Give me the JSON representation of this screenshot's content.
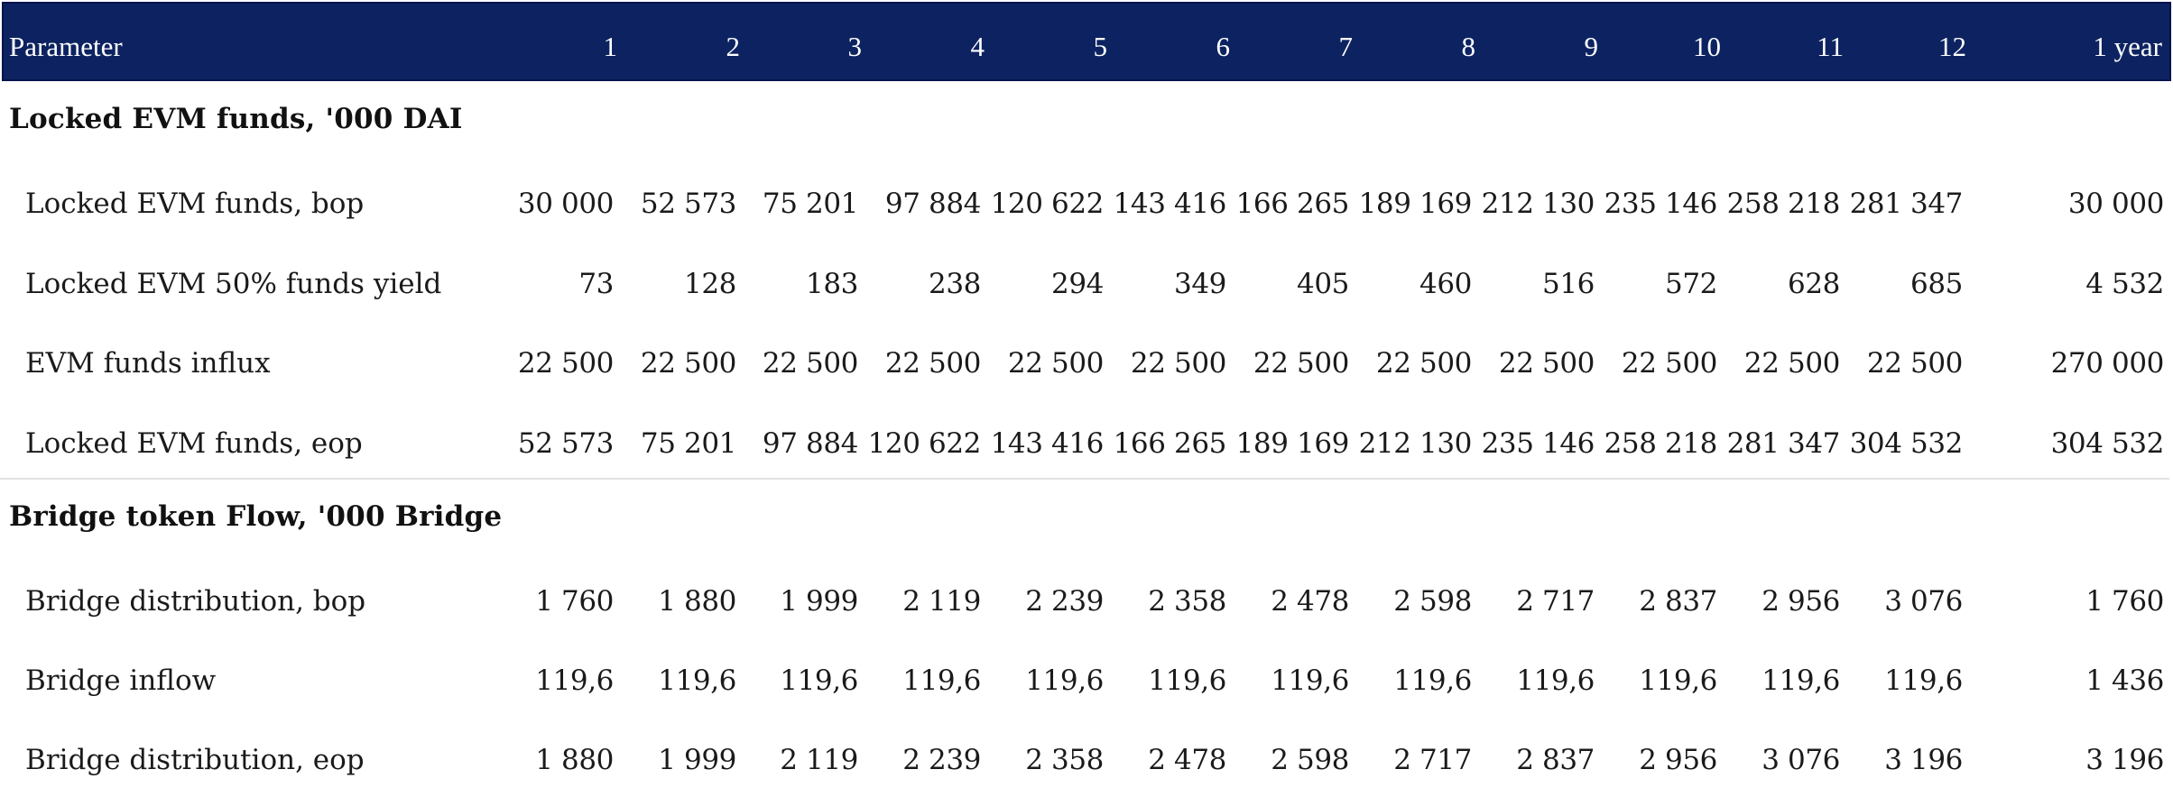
{
  "header": {
    "parameter": "Parameter",
    "months": [
      "1",
      "2",
      "3",
      "4",
      "5",
      "6",
      "7",
      "8",
      "9",
      "10",
      "11",
      "12"
    ],
    "total": "1 year"
  },
  "colors": {
    "header_bg": "#0d2361",
    "header_text": "#ffffff"
  },
  "sections": [
    {
      "title": "Locked EVM funds, '000 DAI",
      "rows": [
        {
          "label": "Locked EVM funds, bop",
          "values": [
            "30 000",
            "52 573",
            "75 201",
            "97 884",
            "120 622",
            "143 416",
            "166 265",
            "189 169",
            "212 130",
            "235 146",
            "258 218",
            "281 347"
          ],
          "total": "30 000"
        },
        {
          "label": "Locked EVM 50% funds yield",
          "values": [
            "73",
            "128",
            "183",
            "238",
            "294",
            "349",
            "405",
            "460",
            "516",
            "572",
            "628",
            "685"
          ],
          "total": "4 532"
        },
        {
          "label": "EVM funds influx",
          "values": [
            "22 500",
            "22 500",
            "22 500",
            "22 500",
            "22 500",
            "22 500",
            "22 500",
            "22 500",
            "22 500",
            "22 500",
            "22 500",
            "22 500"
          ],
          "total": "270 000"
        },
        {
          "label": "Locked EVM funds, eop",
          "values": [
            "52 573",
            "75 201",
            "97 884",
            "120 622",
            "143 416",
            "166 265",
            "189 169",
            "212 130",
            "235 146",
            "258 218",
            "281 347",
            "304 532"
          ],
          "total": "304 532"
        }
      ]
    },
    {
      "title": "Bridge token Flow, '000 Bridge",
      "rows": [
        {
          "label": "Bridge distribution, bop",
          "values": [
            "1 760",
            "1 880",
            "1 999",
            "2 119",
            "2 239",
            "2 358",
            "2 478",
            "2 598",
            "2 717",
            "2 837",
            "2 956",
            "3 076"
          ],
          "total": "1 760"
        },
        {
          "label": "Bridge inflow",
          "values": [
            "119,6",
            "119,6",
            "119,6",
            "119,6",
            "119,6",
            "119,6",
            "119,6",
            "119,6",
            "119,6",
            "119,6",
            "119,6",
            "119,6"
          ],
          "total": "1 436"
        },
        {
          "label": "Bridge distribution, eop",
          "values": [
            "1 880",
            "1 999",
            "2 119",
            "2 239",
            "2 358",
            "2 478",
            "2 598",
            "2 717",
            "2 837",
            "2 956",
            "3 076",
            "3 196"
          ],
          "total": "3 196"
        }
      ]
    }
  ]
}
